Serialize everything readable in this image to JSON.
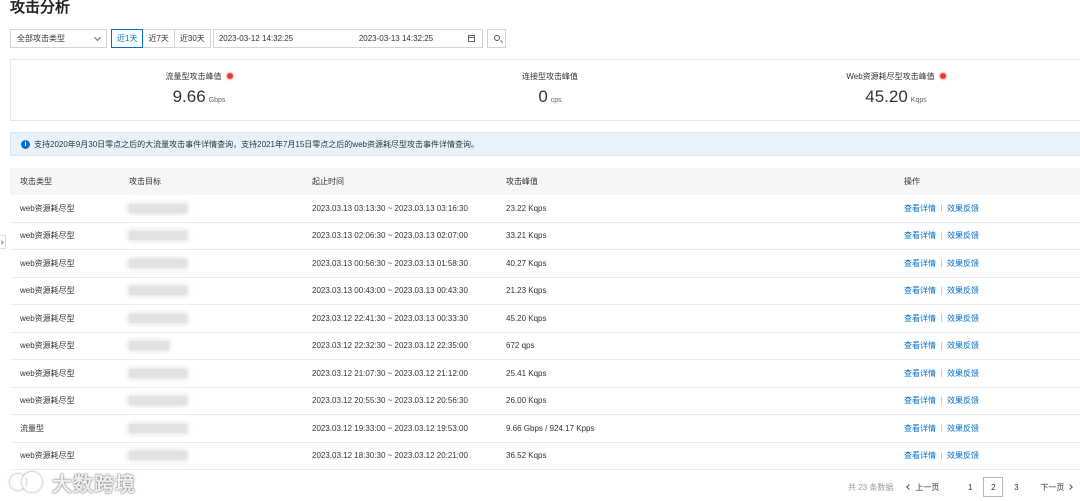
{
  "page": {
    "title": "攻击分析"
  },
  "filters": {
    "attack_type": "全部攻击类型",
    "ranges": [
      "近1天",
      "近7天",
      "近30天"
    ],
    "active_range": "近1天",
    "start_time": "2023-03-12 14:32:25",
    "end_time": "2023-03-13 14:32:25"
  },
  "stats": [
    {
      "label": "流量型攻击峰值",
      "value": "9.66",
      "unit": "Gbps",
      "alert": true
    },
    {
      "label": "连接型攻击峰值",
      "value": "0",
      "unit": "cps",
      "alert": false
    },
    {
      "label": "Web资源耗尽型攻击峰值",
      "value": "45.20",
      "unit": "Kqps",
      "alert": true
    }
  ],
  "notice": "支持2020年9月30日零点之后的大流量攻击事件详情查询，支持2021年7月15日零点之后的web资源耗尽型攻击事件详情查询。",
  "table": {
    "headers": [
      "攻击类型",
      "攻击目标",
      "起止时间",
      "攻击峰值",
      "操作"
    ],
    "action_detail": "查看详情",
    "action_feedback": "效果反馈",
    "rows": [
      {
        "type": "web资源耗尽型",
        "time": "2023.03.13 03:13:30 ~ 2023.03.13 03:16:30",
        "peak": "23.22 Kqps"
      },
      {
        "type": "web资源耗尽型",
        "time": "2023.03.13 02:06:30 ~ 2023.03.13 02:07:00",
        "peak": "33.21 Kqps"
      },
      {
        "type": "web资源耗尽型",
        "time": "2023.03.13 00:56:30 ~ 2023.03.13 01:58:30",
        "peak": "40.27 Kqps"
      },
      {
        "type": "web资源耗尽型",
        "time": "2023.03.13 00:43:00 ~ 2023.03.13 00:43:30",
        "peak": "21.23 Kqps"
      },
      {
        "type": "web资源耗尽型",
        "time": "2023.03.12 22:41:30 ~ 2023.03.13 00:33:30",
        "peak": "45.20 Kqps"
      },
      {
        "type": "web资源耗尽型",
        "time": "2023.03.12 22:32:30 ~ 2023.03.12 22:35:00",
        "peak": "672 qps"
      },
      {
        "type": "web资源耗尽型",
        "time": "2023.03.12 21:07:30 ~ 2023.03.12 21:12:00",
        "peak": "25.41 Kqps"
      },
      {
        "type": "web资源耗尽型",
        "time": "2023.03.12 20:55:30 ~ 2023.03.12 20:56:30",
        "peak": "26.00 Kqps"
      },
      {
        "type": "流量型",
        "time": "2023.03.12 19:33:00 ~ 2023.03.12 19:53:00",
        "peak": "9.66 Gbps / 924.17 Kpps"
      },
      {
        "type": "web资源耗尽型",
        "time": "2023.03.12 18:30:30 ~ 2023.03.12 20:21:00",
        "peak": "36.52 Kqps"
      }
    ]
  },
  "pagination": {
    "total": "共 23 条数据",
    "prev": "上一页",
    "next": "下一页",
    "pages": [
      "1",
      "2",
      "3"
    ],
    "current": "2"
  },
  "watermark": "大数跨境",
  "colors": {
    "accent": "#0070cc",
    "alert": "#e83a3a",
    "notice_bg": "#e9f1fb"
  }
}
